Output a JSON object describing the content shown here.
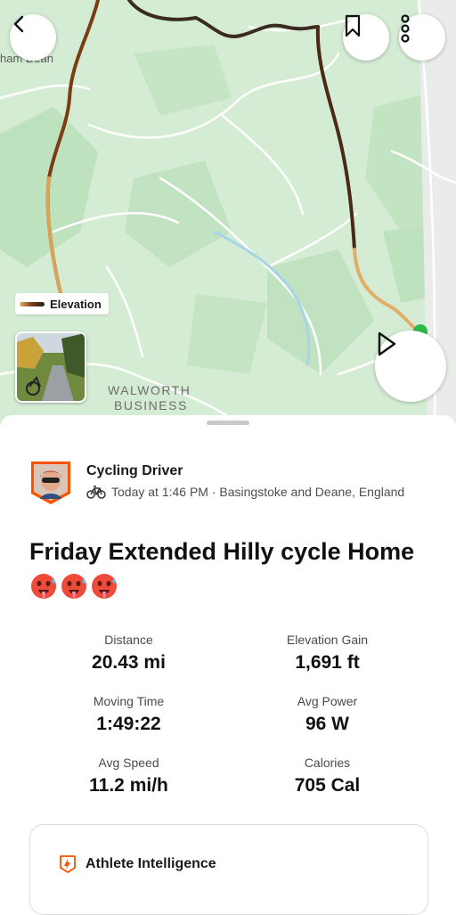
{
  "map": {
    "place_label": "ham Dean",
    "area_label_line1": "WALWORTH",
    "area_label_line2": "BUSINESS",
    "elevation_label": "Elevation",
    "icons": {
      "back": "chevron-left-icon",
      "bookmark": "bookmark-icon",
      "more": "more-vertical-icon",
      "play": "play-icon"
    }
  },
  "athlete": {
    "name": "Cycling Driver",
    "meta": "Today at 1:46 PM · Basingstoke and Deane, England",
    "sport_icon": "bicycle-icon"
  },
  "activity": {
    "title": "Friday Extended Hilly cycle Home",
    "emojis": [
      "hot-face-emoji",
      "hot-face-emoji",
      "hot-face-emoji"
    ]
  },
  "stats": [
    {
      "label": "Distance",
      "value": "20.43 mi"
    },
    {
      "label": "Elevation Gain",
      "value": "1,691 ft"
    },
    {
      "label": "Moving Time",
      "value": "1:49:22"
    },
    {
      "label": "Avg Power",
      "value": "96 W"
    },
    {
      "label": "Avg Speed",
      "value": "11.2 mi/h"
    },
    {
      "label": "Calories",
      "value": "705 Cal"
    }
  ],
  "intelligence": {
    "title": "Athlete Intelligence"
  },
  "colors": {
    "map_green": "#d4ecd3",
    "route_light": "#e6b06a",
    "route_dark": "#1f1f1f",
    "strava_orange": "#fc5200"
  }
}
